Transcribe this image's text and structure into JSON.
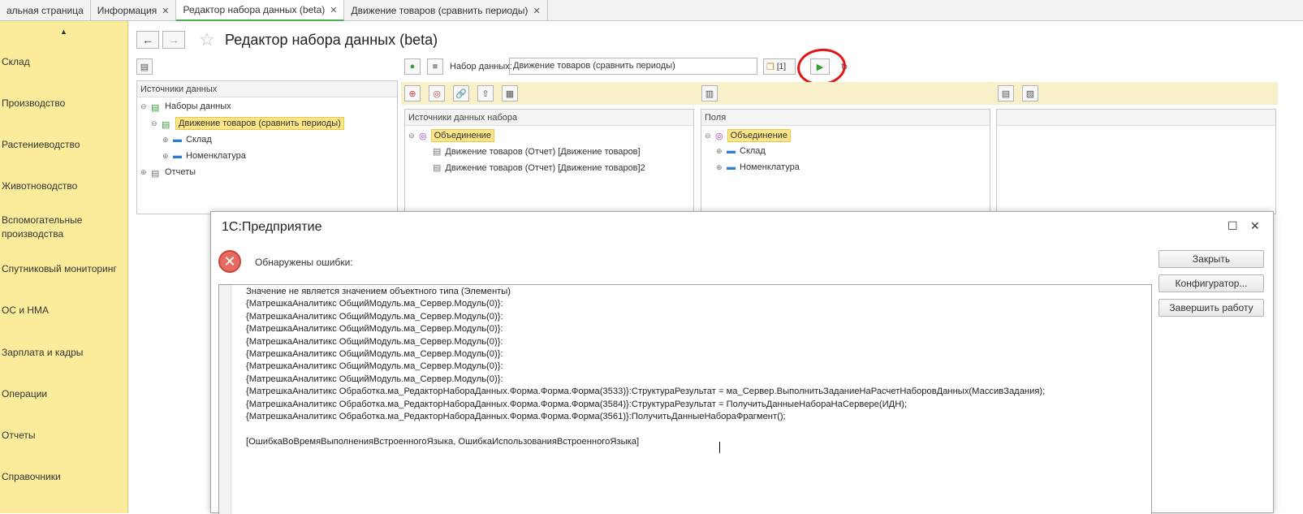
{
  "tabs": [
    {
      "label": "альная страница",
      "closable": false
    },
    {
      "label": "Информация",
      "closable": true
    },
    {
      "label": "Редактор набора данных (beta)",
      "closable": true,
      "active": true
    },
    {
      "label": "Движение товаров (сравнить периоды)",
      "closable": true
    }
  ],
  "sidebar": {
    "items": [
      "Склад",
      "Производство",
      "Растениеводство",
      "Животноводство",
      "Вспомогательные производства",
      "Спутниковый мониторинг",
      "ОС и НМА",
      "Зарплата и кадры",
      "Операции",
      "Отчеты",
      "Справочники"
    ]
  },
  "header": {
    "title": "Редактор набора данных (beta)"
  },
  "toolbar": {
    "dataset_label": "Набор данных:",
    "dataset_value": "Движение товаров (сравнить периоды)",
    "count_label": "[1]"
  },
  "sources_panel": {
    "header": "Источники данных",
    "tree": {
      "root": "Наборы данных",
      "selected": "Движение товаров (сравнить периоды)",
      "children": [
        "Склад",
        "Номенклатура"
      ],
      "reports": "Отчеты"
    }
  },
  "set_sources_panel": {
    "header": "Источники данных набора",
    "root": "Объединение",
    "items": [
      "Движение товаров (Отчет) [Движение товаров]",
      "Движение товаров (Отчет) [Движение товаров]2"
    ]
  },
  "fields_panel": {
    "header": "Поля",
    "root": "Объединение",
    "items": [
      "Склад",
      "Номенклатура"
    ]
  },
  "dialog": {
    "title": "1С:Предприятие",
    "message": "Обнаружены ошибки:",
    "text_lines": [
      "Значение не является значением объектного типа (Элементы)",
      "{МатрешкаАналитикс ОбщийМодуль.ма_Сервер.Модуль(0)}:",
      "{МатрешкаАналитикс ОбщийМодуль.ма_Сервер.Модуль(0)}:",
      "{МатрешкаАналитикс ОбщийМодуль.ма_Сервер.Модуль(0)}:",
      "{МатрешкаАналитикс ОбщийМодуль.ма_Сервер.Модуль(0)}:",
      "{МатрешкаАналитикс ОбщийМодуль.ма_Сервер.Модуль(0)}:",
      "{МатрешкаАналитикс ОбщийМодуль.ма_Сервер.Модуль(0)}:",
      "{МатрешкаАналитикс ОбщийМодуль.ма_Сервер.Модуль(0)}:",
      "{МатрешкаАналитикс Обработка.ма_РедакторНабораДанных.Форма.Форма.Форма(3533)}:СтруктураРезультат = ма_Сервер.ВыполнитьЗаданиеНаРасчетНаборовДанных(МассивЗадания);",
      "{МатрешкаАналитикс Обработка.ма_РедакторНабораДанных.Форма.Форма.Форма(3584)}:СтруктураРезультат = ПолучитьДанныеНабораНаСервере(ИДН);",
      "{МатрешкаАналитикс Обработка.ма_РедакторНабораДанных.Форма.Форма.Форма(3561)}:ПолучитьДанныеНабораФрагмент();",
      "",
      "[ОшибкаВоВремяВыполненияВстроенногоЯзыка, ОшибкаИспользованияВстроенногоЯзыка]"
    ],
    "buttons": {
      "close": "Закрыть",
      "configurator": "Конфигуратор...",
      "exit": "Завершить работу"
    }
  }
}
